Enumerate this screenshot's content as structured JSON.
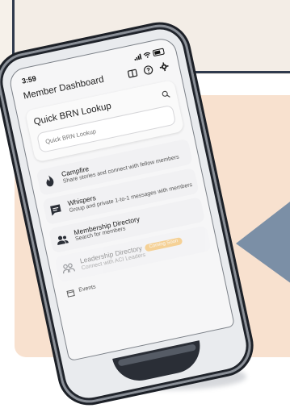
{
  "status_bar": {
    "time": "3:59"
  },
  "header": {
    "title": "Member Dashboard"
  },
  "lookup": {
    "title": "Quick BRN Lookup",
    "placeholder": "Quick BRN Lookup"
  },
  "menu": [
    {
      "id": "campfire",
      "title": "Campfire",
      "subtitle": "Share stories and connect with fellow members",
      "icon": "flame-icon"
    },
    {
      "id": "whispers",
      "title": "Whispers",
      "subtitle": "Group and private 1-to-1 messages with members",
      "icon": "chat-icon"
    },
    {
      "id": "directory",
      "title": "Membership Directory",
      "subtitle": "Search for members",
      "icon": "people-icon"
    },
    {
      "id": "leadership",
      "title": "Leadership Directory",
      "subtitle": "Connect with ACI Leaders",
      "icon": "group-icon",
      "badge": "Coming Soon"
    }
  ],
  "bottom_peek": {
    "label": "Events"
  },
  "colors": {
    "peach": "#f8e1cf",
    "navy": "#2f3a4d",
    "arrow": "#7b8fa6",
    "badge": "#f5a623"
  }
}
